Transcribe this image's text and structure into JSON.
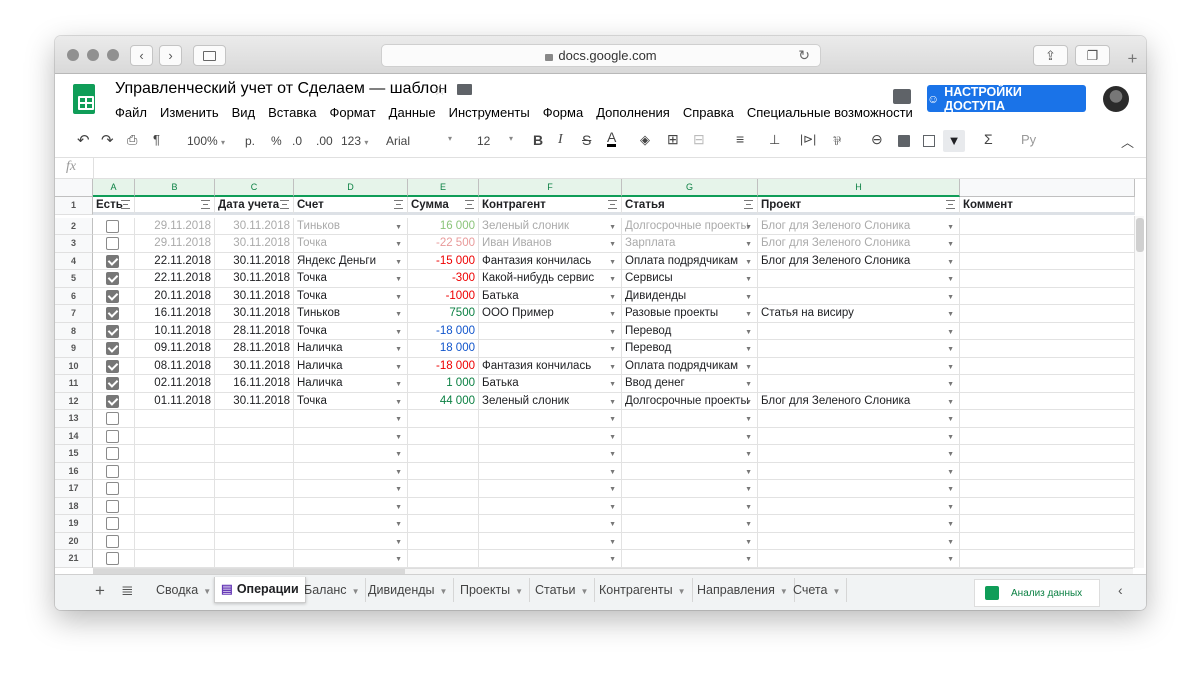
{
  "browser": {
    "url": "docs.google.com",
    "back_icon": "chevron-left",
    "forward_icon": "chevron-right"
  },
  "app": {
    "title": "Управленческий учет от Сделаем — шаблон",
    "menu": [
      "Файл",
      "Изменить",
      "Вид",
      "Вставка",
      "Формат",
      "Данные",
      "Инструменты",
      "Форма",
      "Дополнения",
      "Справка",
      "Специальные возможности"
    ],
    "share_label": "НАСТРОЙКИ ДОСТУПА"
  },
  "toolbar": {
    "zoom": "100%",
    "currency": "р.",
    "percent": "%",
    "dec_less": ".0",
    "dec_more": ".00",
    "format_more": "123",
    "font": "Arial",
    "size": "12",
    "bold": "B",
    "italic": "I",
    "strike": "S",
    "text_color": "A",
    "input_lang": "Ру"
  },
  "formula_bar": {
    "fx": "fx"
  },
  "columns": [
    "A",
    "B",
    "C",
    "D",
    "E",
    "F",
    "G",
    "H",
    ""
  ],
  "headers": {
    "a": "Есть",
    "b": "",
    "c": "Дата учета",
    "d": "Счет",
    "e": "Сумма",
    "f": "Контрагент",
    "g": "Статья",
    "h": "Проект",
    "i": "Коммент"
  },
  "rows": [
    {
      "n": "2",
      "chk": false,
      "b": "29.11.2018",
      "c": "30.11.2018",
      "d": "Тиньков",
      "e": "16 000",
      "f": "Зеленый слоник",
      "g": "Долгосрочные проекты",
      "h": "Блог для Зеленого Слоника",
      "faded": true,
      "ec": "lgreen"
    },
    {
      "n": "3",
      "chk": false,
      "b": "29.11.2018",
      "c": "30.11.2018",
      "d": "Точка",
      "e": "-22 500",
      "f": "Иван Иванов",
      "g": "Зарплата",
      "h": "Блог для Зеленого Слоника",
      "faded": true,
      "ec": "lred"
    },
    {
      "n": "4",
      "chk": true,
      "b": "22.11.2018",
      "c": "30.11.2018",
      "d": "Яндекс Деньги",
      "e": "-15 000",
      "f": "Фантазия кончилась",
      "g": "Оплата подрядчикам",
      "h": "Блог для Зеленого Слоника",
      "ec": "red"
    },
    {
      "n": "5",
      "chk": true,
      "b": "22.11.2018",
      "c": "30.11.2018",
      "d": "Точка",
      "e": "-300",
      "f": "Какой-нибудь сервис",
      "g": "Сервисы",
      "h": "",
      "ec": "red"
    },
    {
      "n": "6",
      "chk": true,
      "b": "20.11.2018",
      "c": "30.11.2018",
      "d": "Точка",
      "e": "-1000",
      "f": "Батька",
      "g": "Дивиденды",
      "h": "",
      "ec": "red"
    },
    {
      "n": "7",
      "chk": true,
      "b": "16.11.2018",
      "c": "30.11.2018",
      "d": "Тиньков",
      "e": "7500",
      "f": "ООО Пример",
      "g": "Разовые проекты",
      "h": "Статья на висиру",
      "ec": "green"
    },
    {
      "n": "8",
      "chk": true,
      "b": "10.11.2018",
      "c": "28.11.2018",
      "d": "Точка",
      "e": "-18 000",
      "f": "",
      "g": "Перевод",
      "h": "",
      "ec": "blue"
    },
    {
      "n": "9",
      "chk": true,
      "b": "09.11.2018",
      "c": "28.11.2018",
      "d": "Наличка",
      "e": "18 000",
      "f": "",
      "g": "Перевод",
      "h": "",
      "ec": "blue"
    },
    {
      "n": "10",
      "chk": true,
      "b": "08.11.2018",
      "c": "30.11.2018",
      "d": "Наличка",
      "e": "-18 000",
      "f": "Фантазия кончилась",
      "g": "Оплата подрядчикам",
      "h": "",
      "ec": "red"
    },
    {
      "n": "11",
      "chk": true,
      "b": "02.11.2018",
      "c": "16.11.2018",
      "d": "Наличка",
      "e": "1 000",
      "f": "Батька",
      "g": "Ввод денег",
      "h": "",
      "ec": "green"
    },
    {
      "n": "12",
      "chk": true,
      "b": "01.11.2018",
      "c": "30.11.2018",
      "d": "Точка",
      "e": "44 000",
      "f": "Зеленый слоник",
      "g": "Долгосрочные проекты",
      "h": "Блог для Зеленого Слоника",
      "ec": "green"
    },
    {
      "n": "13",
      "chk": false,
      "b": "",
      "c": "",
      "d": "",
      "e": "",
      "f": "",
      "g": "",
      "h": ""
    },
    {
      "n": "14",
      "chk": false,
      "b": "",
      "c": "",
      "d": "",
      "e": "",
      "f": "",
      "g": "",
      "h": ""
    },
    {
      "n": "15",
      "chk": false,
      "b": "",
      "c": "",
      "d": "",
      "e": "",
      "f": "",
      "g": "",
      "h": ""
    },
    {
      "n": "16",
      "chk": false,
      "b": "",
      "c": "",
      "d": "",
      "e": "",
      "f": "",
      "g": "",
      "h": ""
    },
    {
      "n": "17",
      "chk": false,
      "b": "",
      "c": "",
      "d": "",
      "e": "",
      "f": "",
      "g": "",
      "h": ""
    },
    {
      "n": "18",
      "chk": false,
      "b": "",
      "c": "",
      "d": "",
      "e": "",
      "f": "",
      "g": "",
      "h": ""
    },
    {
      "n": "19",
      "chk": false,
      "b": "",
      "c": "",
      "d": "",
      "e": "",
      "f": "",
      "g": "",
      "h": ""
    },
    {
      "n": "20",
      "chk": false,
      "b": "",
      "c": "",
      "d": "",
      "e": "",
      "f": "",
      "g": "",
      "h": ""
    },
    {
      "n": "21",
      "chk": false,
      "b": "",
      "c": "",
      "d": "",
      "e": "",
      "f": "",
      "g": "",
      "h": ""
    }
  ],
  "row_header_1": "1",
  "tabs": [
    {
      "label": "Сводка",
      "active": false
    },
    {
      "label": "Операции",
      "active": true
    },
    {
      "label": "Баланс",
      "active": false
    },
    {
      "label": "Дивиденды",
      "active": false
    },
    {
      "label": "Проекты",
      "active": false
    },
    {
      "label": "Статьи",
      "active": false
    },
    {
      "label": "Контрагенты",
      "active": false
    },
    {
      "label": "Направления",
      "active": false
    },
    {
      "label": "Счета",
      "active": false
    }
  ],
  "explore_label": "Анализ данных",
  "colors": {
    "accent": "#0f9d58",
    "share": "#1a73e8",
    "negative": "#ee0000",
    "positive": "#0b8043",
    "transfer": "#1155cc"
  }
}
